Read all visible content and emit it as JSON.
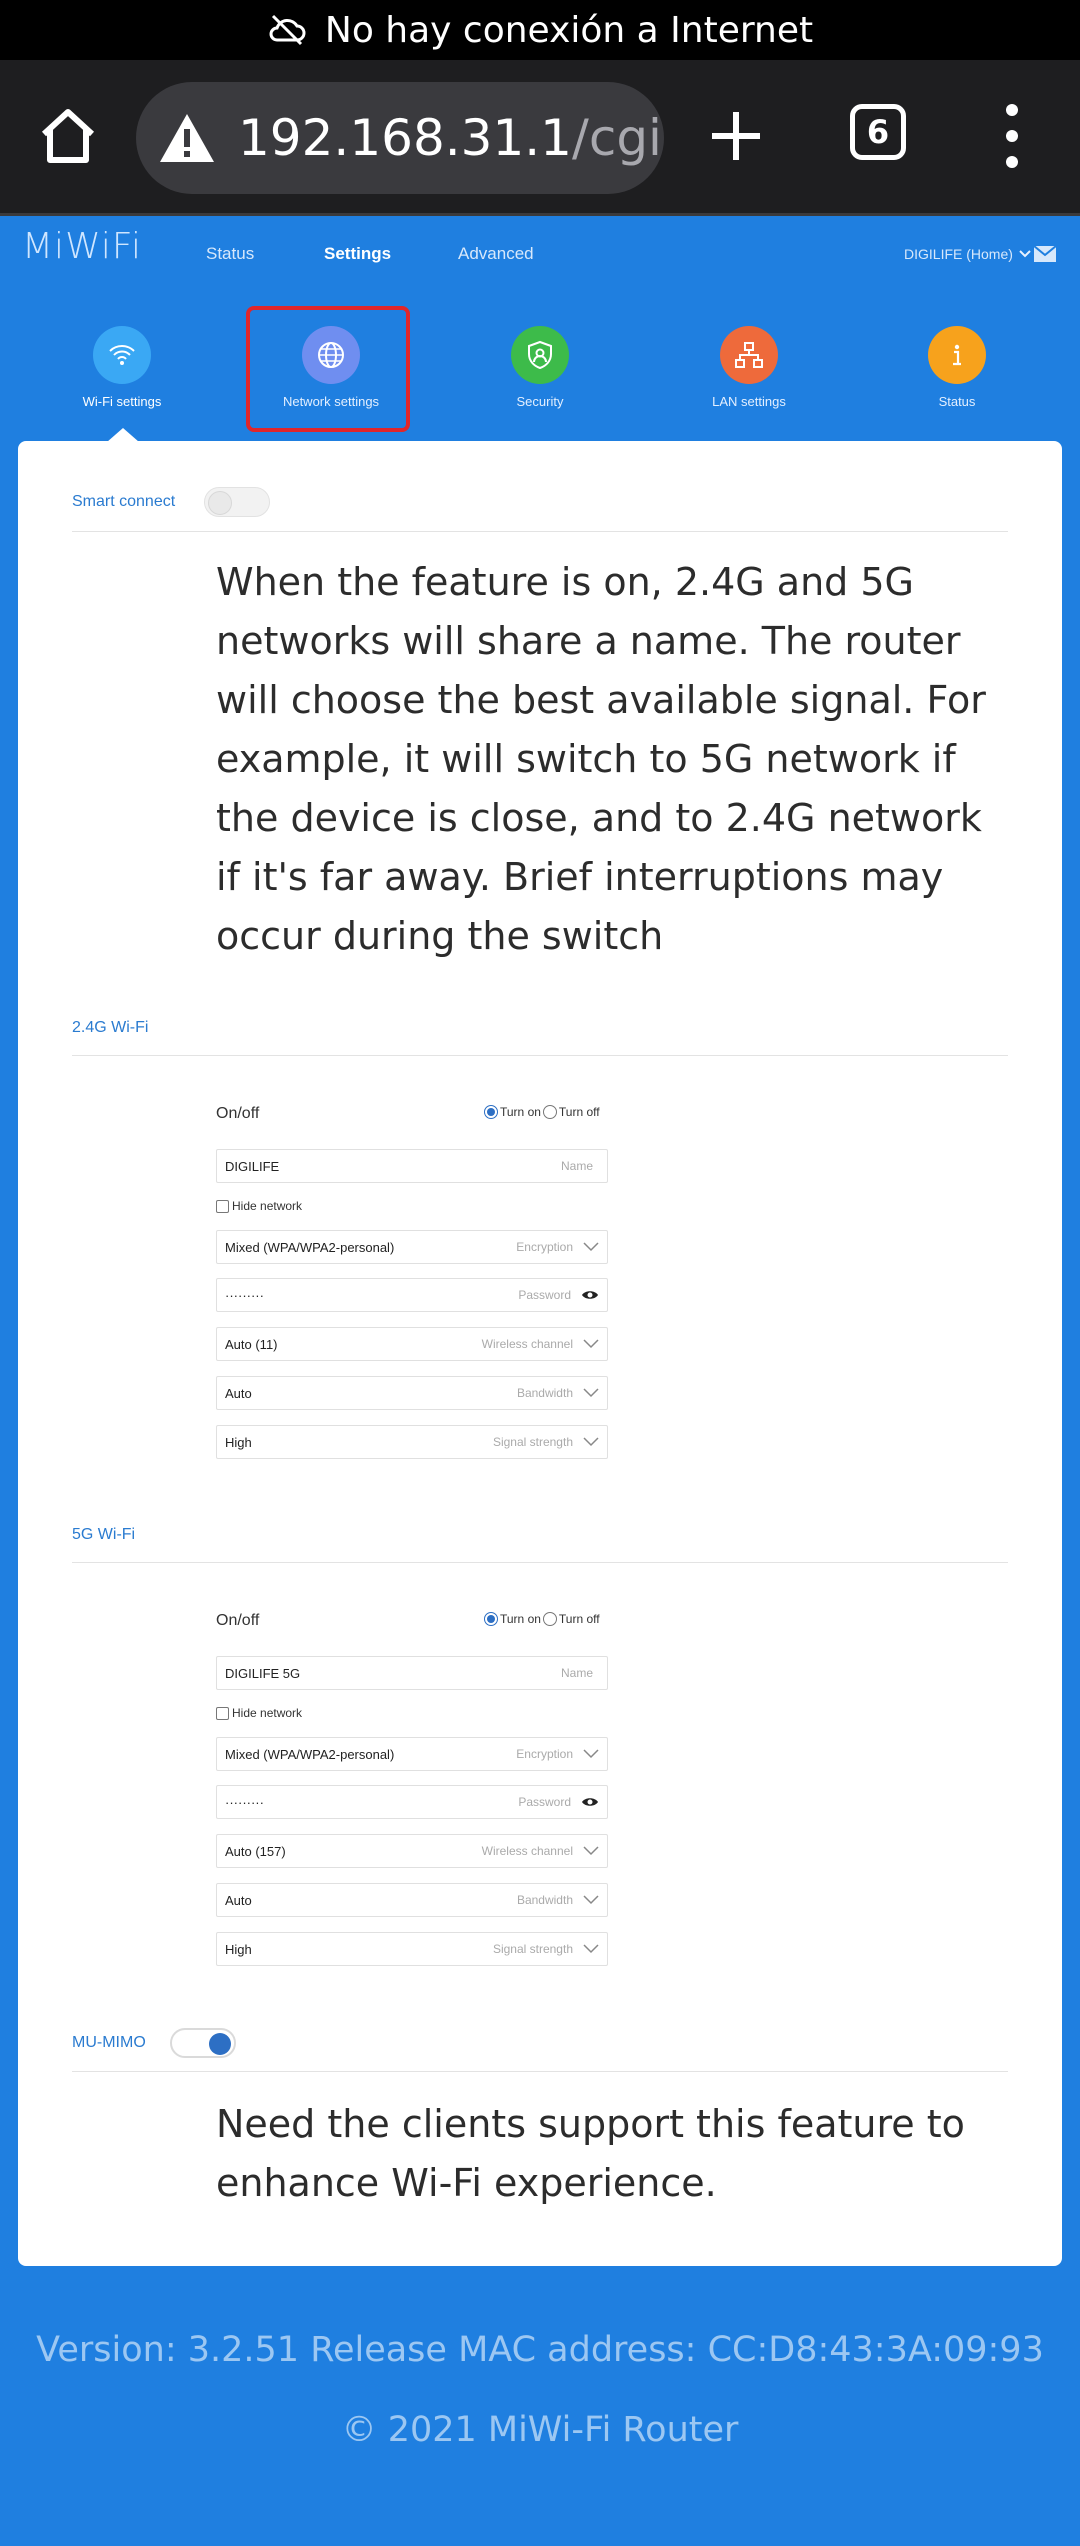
{
  "status_bar": {
    "message": "No hay conexión a Internet",
    "icon": "cloud-off-icon"
  },
  "browser": {
    "url_host": "192.168.31.1",
    "url_path": "/cgi-bin",
    "tab_count": "6"
  },
  "header": {
    "logo": "MiWiFi",
    "nav": [
      "Status",
      "Settings",
      "Advanced"
    ],
    "active_nav": "Settings",
    "user": "DIGILIFE (Home)"
  },
  "categories": [
    {
      "label": "Wi-Fi settings",
      "color": "#3aa8f4"
    },
    {
      "label": "Network settings",
      "color": "#6f8ef0"
    },
    {
      "label": "Security",
      "color": "#3dbb4a"
    },
    {
      "label": "LAN settings",
      "color": "#ee6a3b"
    },
    {
      "label": "Status",
      "color": "#f7a21c"
    }
  ],
  "smart_connect": {
    "label": "Smart connect",
    "enabled": false,
    "description": "When the feature is on, 2.4G and 5G networks will share a name. The router will choose the best available signal. For example, it will switch to 5G network if the device is close, and to 2.4G network if it's far away. Brief interruptions may occur during the switch"
  },
  "wifi_24": {
    "title": "2.4G Wi-Fi",
    "onoff_label": "On/off",
    "turn_on": "Turn on",
    "turn_off": "Turn off",
    "name": {
      "value": "DIGILIFE",
      "placeholder": "Name"
    },
    "hide_network": "Hide network",
    "encryption": {
      "value": "Mixed (WPA/WPA2-personal)",
      "placeholder": "Encryption"
    },
    "password": {
      "value": "·········",
      "placeholder": "Password"
    },
    "channel": {
      "value": "Auto (11)",
      "placeholder": "Wireless channel"
    },
    "bandwidth": {
      "value": "Auto",
      "placeholder": "Bandwidth"
    },
    "signal": {
      "value": "High",
      "placeholder": "Signal strength"
    }
  },
  "wifi_5": {
    "title": "5G Wi-Fi",
    "onoff_label": "On/off",
    "turn_on": "Turn on",
    "turn_off": "Turn off",
    "name": {
      "value": "DIGILIFE 5G",
      "placeholder": "Name"
    },
    "hide_network": "Hide network",
    "encryption": {
      "value": "Mixed (WPA/WPA2-personal)",
      "placeholder": "Encryption"
    },
    "password": {
      "value": "·········",
      "placeholder": "Password"
    },
    "channel": {
      "value": "Auto (157)",
      "placeholder": "Wireless channel"
    },
    "bandwidth": {
      "value": "Auto",
      "placeholder": "Bandwidth"
    },
    "signal": {
      "value": "High",
      "placeholder": "Signal strength"
    }
  },
  "mu_mimo": {
    "label": "MU-MIMO",
    "enabled": true,
    "description": "Need the clients support this feature to enhance Wi-Fi experience."
  },
  "footer": {
    "version": "Version: 3.2.51 Release  MAC address: CC:D8:43:3A:09:93",
    "copyright": "© 2021 MiWi-Fi Router"
  }
}
